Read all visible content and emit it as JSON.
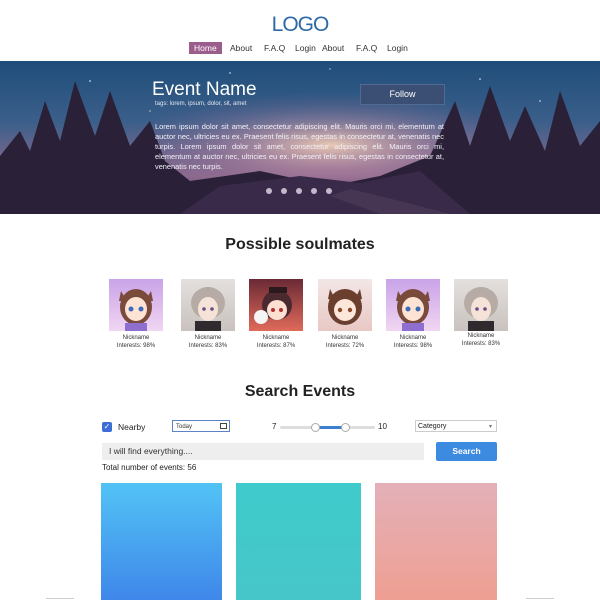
{
  "header": {
    "logo": "LOGO",
    "nav": [
      {
        "label": "Home",
        "active": true
      },
      {
        "label": "About"
      },
      {
        "label": "F.A.Q"
      },
      {
        "label": "Login"
      },
      {
        "label": "About"
      },
      {
        "label": "F.A.Q"
      },
      {
        "label": "Login"
      }
    ]
  },
  "hero": {
    "title": "Event Name",
    "tags": "tags: lorem, ipsum, dolor, sit, amet",
    "follow_label": "Follow",
    "description": "Lorem ipsum dolor sit amet, consectetur adipiscing elit. Mauris orci mi, elementum at auctor nec, ultricies eu ex. Praesent felis risus, egestas in consectetur at, venenatis nec turpis. Lorem ipsum dolor sit amet, consectetur adipiscing elit. Mauris orci mi, elementum at auctor nec, ultricies eu ex. Praesent felis risus, egestas in consectetur at, venenatis nec turpis.",
    "carousel_dots": 5
  },
  "soulmates": {
    "title": "Possible soulmates",
    "people": [
      {
        "nickname": "Nickname",
        "interests": "Interests: 98%"
      },
      {
        "nickname": "Nickname",
        "interests": "Interests: 83%"
      },
      {
        "nickname": "Nickname",
        "interests": "Interests: 87%"
      },
      {
        "nickname": "Nickname",
        "interests": "Interests: 72%"
      },
      {
        "nickname": "Nickname",
        "interests": "Interests: 98%"
      },
      {
        "nickname": "Nickname",
        "interests": "Interests: 83%"
      }
    ]
  },
  "search": {
    "title": "Search Events",
    "nearby_label": "Nearby",
    "nearby_checked": true,
    "date_value": "Today",
    "range_min": "7",
    "range_max": "10",
    "category_value": "Category",
    "placeholder": "I will find everything....",
    "button_label": "Search",
    "total_label": "Total number of events: 56"
  },
  "cards": [
    {
      "color_top": "#52c3f5",
      "color_bottom": "#3f87ea"
    },
    {
      "color_top": "#3fcbcb",
      "color_bottom": "#47c6c9"
    },
    {
      "color_top": "#e3b0b8",
      "color_bottom": "#ef9f92"
    }
  ]
}
